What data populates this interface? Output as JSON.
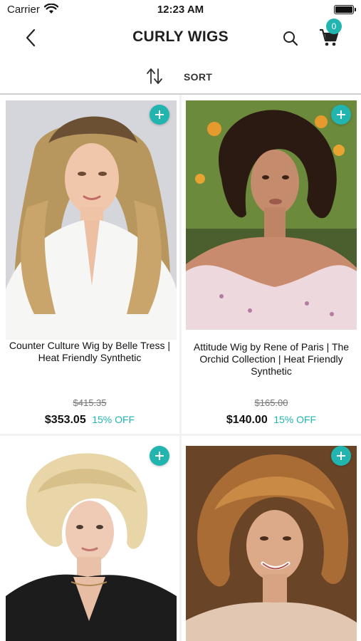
{
  "status_bar": {
    "carrier": "Carrier",
    "time": "12:23 AM"
  },
  "nav": {
    "title": "CURLY WIGS",
    "cart_count": "0"
  },
  "sort": {
    "label": "SORT"
  },
  "products": [
    {
      "name": "Counter Culture Wig by Belle Tress | Heat Friendly Synthetic",
      "original_price": "$415.35",
      "price": "$353.05",
      "discount": "15% OFF"
    },
    {
      "name": "Attitude Wig by Rene of Paris | The Orchid Collection | Heat Friendly Synthetic",
      "original_price": "$165.00",
      "price": "$140.00",
      "discount": "15% OFF"
    },
    {
      "name": "",
      "original_price": "",
      "price": "",
      "discount": ""
    },
    {
      "name": "",
      "original_price": "",
      "price": "",
      "discount": ""
    }
  ],
  "colors": {
    "accent": "#22b5b0"
  }
}
